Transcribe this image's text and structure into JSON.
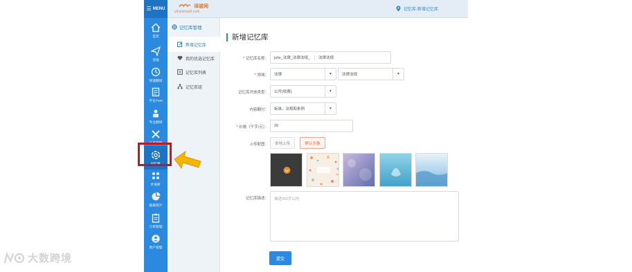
{
  "rail": {
    "menu_label": "MENU",
    "items": [
      {
        "label": "首页",
        "icon": "home-icon"
      },
      {
        "label": "话语",
        "icon": "send-icon"
      },
      {
        "label": "快速翻译",
        "icon": "clock-icon"
      },
      {
        "label": "平台TMX",
        "icon": "document-icon"
      },
      {
        "label": "专业翻译",
        "icon": "person-icon"
      },
      {
        "label": "任务管理",
        "icon": "tools-icon"
      },
      {
        "label": "记忆库",
        "icon": "lifebuoy-icon"
      },
      {
        "label": "术语库",
        "icon": "grid-dots-icon"
      },
      {
        "label": "报表统计",
        "icon": "pie-chart-icon"
      },
      {
        "label": "订单管理",
        "icon": "clipboard-icon"
      },
      {
        "label": "用户管理",
        "icon": "user-circle-icon"
      }
    ],
    "active_index": 6
  },
  "topbar": {
    "logo_text": "译骏网",
    "logo_url": "ytranemall.com",
    "breadcrumb": "记忆库-新增记忆库"
  },
  "submenu": {
    "title": "记忆库管理",
    "items": [
      {
        "label": "新增记忆库",
        "icon": "edit-icon"
      },
      {
        "label": "我的优选记忆库",
        "icon": "heart-icon"
      },
      {
        "label": "记忆库列表",
        "icon": "list-icon"
      },
      {
        "label": "记忆库组",
        "icon": "org-icon"
      }
    ],
    "active_index": 0
  },
  "form": {
    "title": "新增记忆库",
    "name_label": "记忆库名称：",
    "name_prefix": "julie_法律_法律法规_",
    "name_value": "法律法规",
    "domain_label": "领域：",
    "domain_value": "法律",
    "subdomain_value": "法律法规",
    "open_type_label": "记忆库开放类型：",
    "open_type_value": "公开(收费)",
    "content_label": "内容翻付：",
    "content_value": "标准，法规和条例",
    "price_label": "价格（千字/元）：",
    "price_value": "20",
    "upload_label": "上传配图：",
    "upload_local": "本地上传",
    "upload_default": "默认头像",
    "description_label": "记忆库描述：",
    "description_placeholder": "描述200字以内",
    "submit_label": "提交"
  },
  "colors": {
    "rail_blue": "#2b8ae0",
    "highlight_red": "#c8141c",
    "arrow_yellow": "#f5b400"
  },
  "watermark": {
    "text": "大数跨境"
  }
}
